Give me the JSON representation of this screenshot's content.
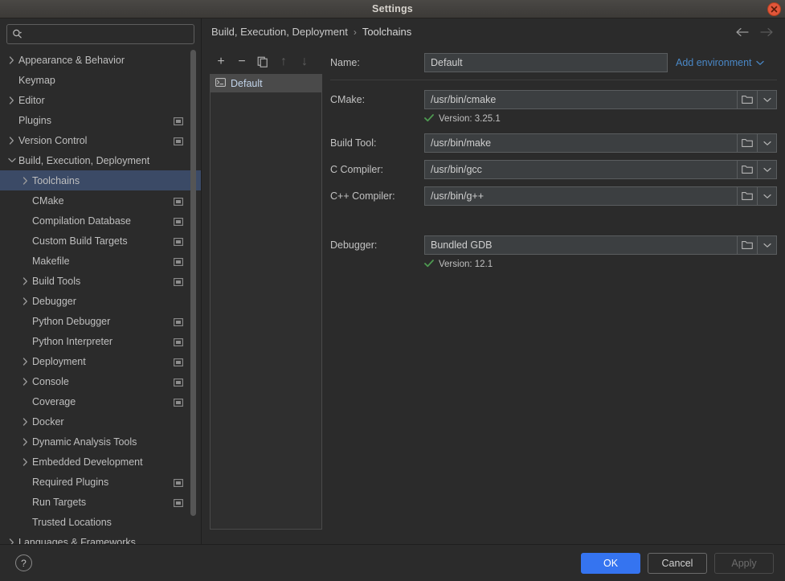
{
  "window": {
    "title": "Settings",
    "close_icon": "close-icon"
  },
  "search": {
    "placeholder": "",
    "value": "",
    "icon": "search-icon"
  },
  "sidebar": {
    "items": [
      {
        "label": "Appearance & Behavior",
        "indent": 0,
        "arrow": "right",
        "badge": false,
        "selected": false
      },
      {
        "label": "Keymap",
        "indent": 0,
        "arrow": "none",
        "badge": false,
        "selected": false
      },
      {
        "label": "Editor",
        "indent": 0,
        "arrow": "right",
        "badge": false,
        "selected": false
      },
      {
        "label": "Plugins",
        "indent": 0,
        "arrow": "none",
        "badge": true,
        "selected": false
      },
      {
        "label": "Version Control",
        "indent": 0,
        "arrow": "right",
        "badge": true,
        "selected": false
      },
      {
        "label": "Build, Execution, Deployment",
        "indent": 0,
        "arrow": "down",
        "badge": false,
        "selected": false
      },
      {
        "label": "Toolchains",
        "indent": 1,
        "arrow": "right",
        "badge": false,
        "selected": true
      },
      {
        "label": "CMake",
        "indent": 1,
        "arrow": "none",
        "badge": true,
        "selected": false
      },
      {
        "label": "Compilation Database",
        "indent": 1,
        "arrow": "none",
        "badge": true,
        "selected": false
      },
      {
        "label": "Custom Build Targets",
        "indent": 1,
        "arrow": "none",
        "badge": true,
        "selected": false
      },
      {
        "label": "Makefile",
        "indent": 1,
        "arrow": "none",
        "badge": true,
        "selected": false
      },
      {
        "label": "Build Tools",
        "indent": 1,
        "arrow": "right",
        "badge": true,
        "selected": false
      },
      {
        "label": "Debugger",
        "indent": 1,
        "arrow": "right",
        "badge": false,
        "selected": false
      },
      {
        "label": "Python Debugger",
        "indent": 1,
        "arrow": "none",
        "badge": true,
        "selected": false
      },
      {
        "label": "Python Interpreter",
        "indent": 1,
        "arrow": "none",
        "badge": true,
        "selected": false
      },
      {
        "label": "Deployment",
        "indent": 1,
        "arrow": "right",
        "badge": true,
        "selected": false
      },
      {
        "label": "Console",
        "indent": 1,
        "arrow": "right",
        "badge": true,
        "selected": false
      },
      {
        "label": "Coverage",
        "indent": 1,
        "arrow": "none",
        "badge": true,
        "selected": false
      },
      {
        "label": "Docker",
        "indent": 1,
        "arrow": "right",
        "badge": false,
        "selected": false
      },
      {
        "label": "Dynamic Analysis Tools",
        "indent": 1,
        "arrow": "right",
        "badge": false,
        "selected": false
      },
      {
        "label": "Embedded Development",
        "indent": 1,
        "arrow": "right",
        "badge": false,
        "selected": false
      },
      {
        "label": "Required Plugins",
        "indent": 1,
        "arrow": "none",
        "badge": true,
        "selected": false
      },
      {
        "label": "Run Targets",
        "indent": 1,
        "arrow": "none",
        "badge": true,
        "selected": false
      },
      {
        "label": "Trusted Locations",
        "indent": 1,
        "arrow": "none",
        "badge": false,
        "selected": false
      },
      {
        "label": "Languages & Frameworks",
        "indent": 0,
        "arrow": "right",
        "badge": false,
        "selected": false
      }
    ]
  },
  "breadcrumb": {
    "parent": "Build, Execution, Deployment",
    "separator": "›",
    "current": "Toolchains",
    "back_icon": "arrow-left-icon",
    "forward_icon": "arrow-right-icon"
  },
  "toolchain_list": {
    "toolbar": [
      {
        "name": "add-toolchain-button",
        "glyph": "+",
        "disabled": false
      },
      {
        "name": "remove-toolchain-button",
        "glyph": "−",
        "disabled": false
      },
      {
        "name": "copy-toolchain-button",
        "glyph": "copy-icon",
        "disabled": false
      },
      {
        "name": "move-up-button",
        "glyph": "↑",
        "disabled": true
      },
      {
        "name": "move-down-button",
        "glyph": "↓",
        "disabled": true
      }
    ],
    "items": [
      {
        "label": "Default",
        "icon": "terminal-icon",
        "selected": true
      }
    ]
  },
  "form": {
    "name": {
      "label": "Name:",
      "value": "Default"
    },
    "add_environment": {
      "label": "Add environment",
      "chevron": "chevron-down-icon"
    },
    "fields": [
      {
        "label": "CMake:",
        "value": "/usr/bin/cmake",
        "browse_icon": "folder-icon",
        "dropdown_icon": "chevron-down-icon",
        "status": {
          "icon": "check-icon",
          "text": "Version: 3.25.1",
          "color": "#4e9a51"
        }
      },
      {
        "label": "Build Tool:",
        "value": "/usr/bin/make",
        "browse_icon": "folder-icon",
        "dropdown_icon": "chevron-down-icon",
        "status": null
      },
      {
        "label": "C Compiler:",
        "value": "/usr/bin/gcc",
        "browse_icon": "folder-icon",
        "dropdown_icon": "chevron-down-icon",
        "status": null
      },
      {
        "label": "C++ Compiler:",
        "value": "/usr/bin/g++",
        "browse_icon": "folder-icon",
        "dropdown_icon": "chevron-down-icon",
        "status": null
      },
      {
        "label": "Debugger:",
        "value": "Bundled GDB",
        "browse_icon": "folder-icon",
        "dropdown_icon": "chevron-down-icon",
        "status": {
          "icon": "check-icon",
          "text": "Version: 12.1",
          "color": "#4e9a51"
        }
      }
    ]
  },
  "footer": {
    "help": "?",
    "ok": "OK",
    "cancel": "Cancel",
    "apply": "Apply"
  },
  "colors": {
    "accent_blue": "#3574f0",
    "selection_blue": "#3b4a66",
    "link_blue": "#4a88c7",
    "success_green": "#4e9a51",
    "bg": "#2b2b2b",
    "field_bg": "#3c3f41"
  }
}
